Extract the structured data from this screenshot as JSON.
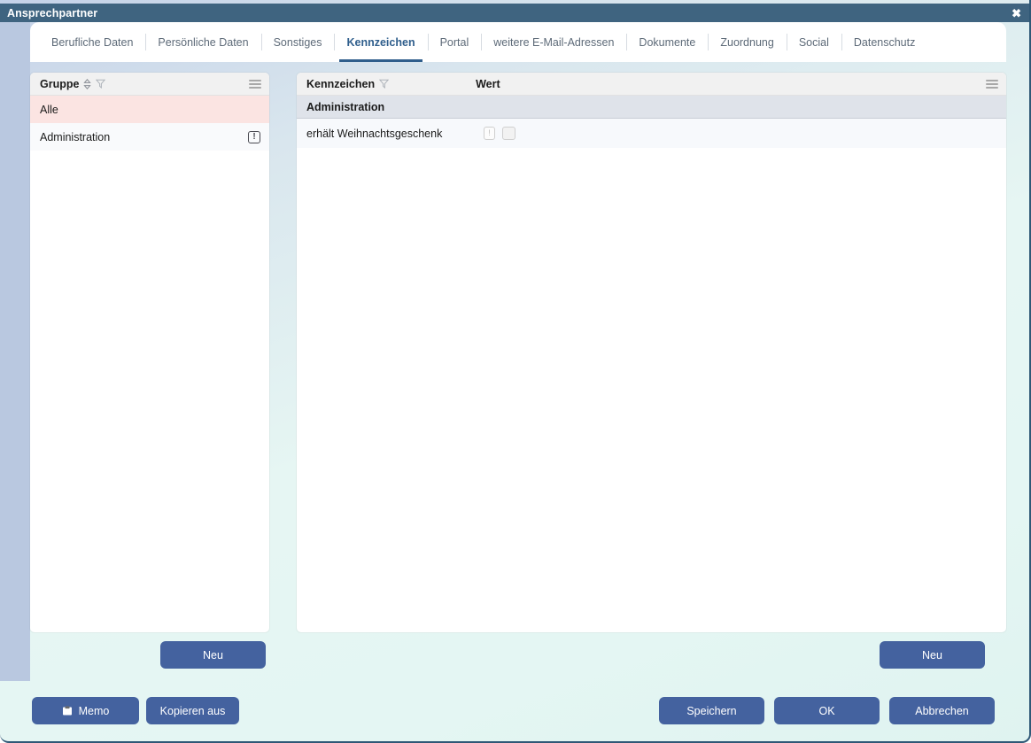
{
  "window": {
    "title": "Ansprechpartner",
    "close_label": "✖",
    "ghost_strip_text": "░░ ░░░░░░░░ ░░░░ ░░░ ░░░░░ ░░"
  },
  "tabs": [
    {
      "label": "Berufliche Daten",
      "active": false
    },
    {
      "label": "Persönliche Daten",
      "active": false
    },
    {
      "label": "Sonstiges",
      "active": false
    },
    {
      "label": "Kennzeichen",
      "active": true
    },
    {
      "label": "Portal",
      "active": false
    },
    {
      "label": "weitere E-Mail-Adressen",
      "active": false
    },
    {
      "label": "Dokumente",
      "active": false
    },
    {
      "label": "Zuordnung",
      "active": false
    },
    {
      "label": "Social",
      "active": false
    },
    {
      "label": "Datenschutz",
      "active": false
    }
  ],
  "left_panel": {
    "column_header": "Gruppe",
    "sort_icon": "sort-ascending-descending-icon",
    "filter_icon": "filter-funnel-icon",
    "menu_icon": "hamburger-menu-icon",
    "rows": [
      {
        "label": "Alle",
        "selected": true,
        "has_alert_icon": false
      },
      {
        "label": "Administration",
        "selected": false,
        "has_alert_icon": true,
        "alert_glyph": "!"
      }
    ]
  },
  "right_panel": {
    "columns": [
      {
        "label": "Kennzeichen",
        "filter_icon": "filter-funnel-icon"
      },
      {
        "label": "Wert"
      }
    ],
    "menu_icon": "hamburger-menu-icon",
    "groups": [
      {
        "title": "Administration",
        "rows": [
          {
            "label": "erhält Weihnachtsgeschenk",
            "info_glyph": "!",
            "checkbox_checked": false
          }
        ]
      }
    ]
  },
  "buttons": {
    "neu_left": "Neu",
    "neu_right": "Neu",
    "memo": "Memo",
    "memo_icon": "note-memo-icon",
    "kopieren_aus": "Kopieren aus",
    "speichern": "Speichern",
    "ok": "OK",
    "abbrechen": "Abbrechen"
  },
  "colors": {
    "titlebar": "#3f6480",
    "accent_blue": "#2f5e8c",
    "button_blue": "#44629f",
    "selected_row": "#fbe4e2",
    "group_row": "#dfe3ea",
    "left_band": "#b9c8e0"
  }
}
